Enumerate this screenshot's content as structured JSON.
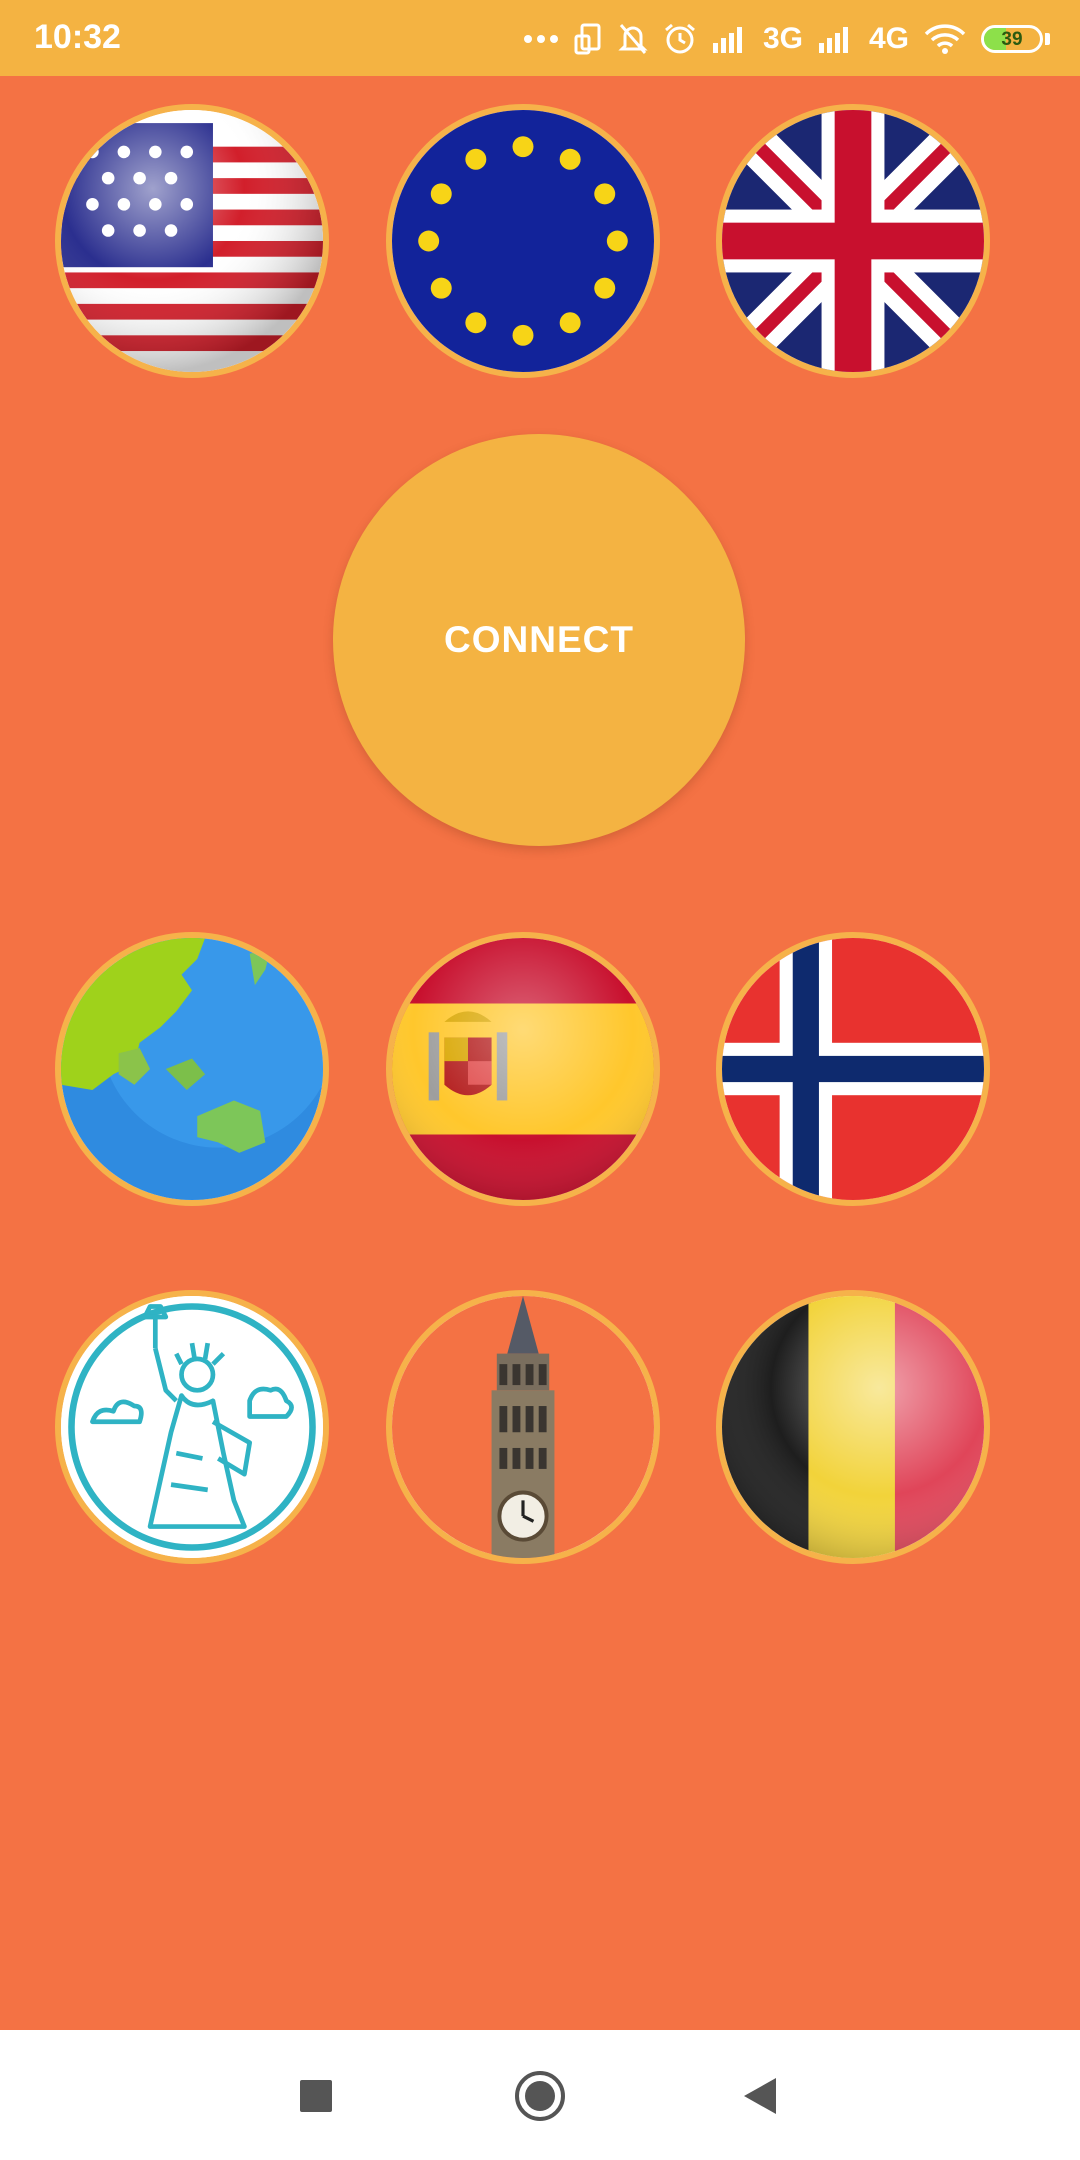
{
  "status_bar": {
    "time": "10:32",
    "network_3g": "3G",
    "network_4g": "4G",
    "battery": "39",
    "battery_level": 0.39,
    "icons": [
      "more-dots-icon",
      "rotate-icon",
      "mute-bell-icon",
      "alarm-icon",
      "signal-icon",
      "signal-icon",
      "wifi-icon",
      "battery-icon"
    ]
  },
  "connect_button": {
    "label": "CONNECT",
    "color": "#F4B342"
  },
  "colors": {
    "background": "#F47244",
    "status_bar": "#F4B342",
    "ring": "#F6B24A"
  },
  "servers": [
    {
      "icon": "usa-flag-icon"
    },
    {
      "icon": "eu-flag-icon"
    },
    {
      "icon": "uk-flag-icon"
    },
    {
      "icon": "globe-icon"
    },
    {
      "icon": "spain-flag-icon"
    },
    {
      "icon": "norway-flag-icon"
    },
    {
      "icon": "statue-of-liberty-icon"
    },
    {
      "icon": "big-ben-icon"
    },
    {
      "icon": "belgium-flag-icon"
    }
  ],
  "nav_bar": {
    "icons": [
      "recents-square-icon",
      "home-circle-icon",
      "back-triangle-icon"
    ]
  }
}
